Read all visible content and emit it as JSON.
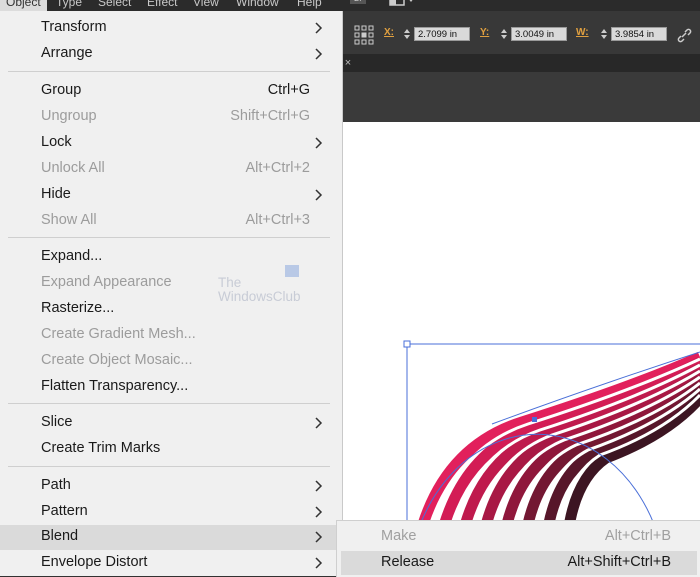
{
  "menubar": {
    "items": [
      "Object",
      "Type",
      "Select",
      "Effect",
      "View",
      "Window",
      "Help"
    ],
    "br_badge": "Br"
  },
  "control_bar": {
    "x_label": "X:",
    "x_value": "2.7099 in",
    "y_label": "Y:",
    "y_value": "3.0049 in",
    "w_label": "W:",
    "w_value": "3.9854 in"
  },
  "tab_close": "×",
  "watermark": {
    "line1": "The",
    "line2": "WindowsClub"
  },
  "object_menu": {
    "items": [
      {
        "label": "Transform",
        "submenu": true
      },
      {
        "label": "Arrange",
        "submenu": true
      },
      {
        "label": "Group",
        "shortcut": "Ctrl+G"
      },
      {
        "label": "Ungroup",
        "shortcut": "Shift+Ctrl+G",
        "disabled": true
      },
      {
        "label": "Lock",
        "submenu": true
      },
      {
        "label": "Unlock All",
        "shortcut": "Alt+Ctrl+2",
        "disabled": true
      },
      {
        "label": "Hide",
        "submenu": true
      },
      {
        "label": "Show All",
        "shortcut": "Alt+Ctrl+3",
        "disabled": true
      },
      {
        "label": "Expand..."
      },
      {
        "label": "Expand Appearance",
        "disabled": true
      },
      {
        "label": "Rasterize..."
      },
      {
        "label": "Create Gradient Mesh...",
        "disabled": true
      },
      {
        "label": "Create Object Mosaic...",
        "disabled": true
      },
      {
        "label": "Flatten Transparency..."
      },
      {
        "label": "Slice",
        "submenu": true
      },
      {
        "label": "Create Trim Marks"
      },
      {
        "label": "Path",
        "submenu": true
      },
      {
        "label": "Pattern",
        "submenu": true
      },
      {
        "label": "Blend",
        "submenu": true,
        "highlighted": true
      },
      {
        "label": "Envelope Distort",
        "submenu": true
      }
    ]
  },
  "blend_submenu": {
    "items": [
      {
        "label": "Make",
        "shortcut": "Alt+Ctrl+B",
        "disabled": true
      },
      {
        "label": "Release",
        "shortcut": "Alt+Shift+Ctrl+B",
        "highlighted": true
      }
    ]
  },
  "colors": {
    "blend_start": "#e01e5a",
    "blend_end": "#1a1418",
    "selection": "#4a6fd8",
    "menu_bg": "#f0f0f0",
    "highlight": "#dadada"
  }
}
